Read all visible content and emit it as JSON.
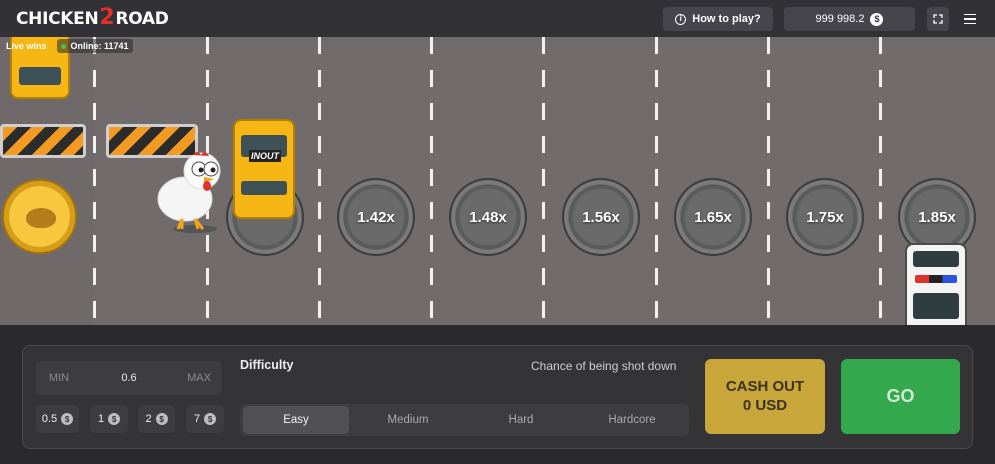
{
  "header": {
    "logo_left": "CHICKEN",
    "logo_num": "2",
    "logo_right": "ROAD",
    "how_to_play": "How to play?",
    "balance": "999 998.2",
    "currency_symbol": "$",
    "icons": [
      "info-icon",
      "coin-icon",
      "fullscreen-icon",
      "menu-icon"
    ]
  },
  "live": {
    "live_wins_label": "Live wins",
    "online_label": "Online: 11741",
    "online_dot_color": "#3ec35a"
  },
  "road": {
    "car_label": "INOUT",
    "multipliers": [
      "1.42x",
      "1.48x",
      "1.56x",
      "1.65x",
      "1.75x",
      "1.85x"
    ]
  },
  "controls": {
    "bet": {
      "min_label": "MIN",
      "value": "0.6",
      "max_label": "MAX"
    },
    "quick_bets": [
      "0.5",
      "1",
      "2",
      "7"
    ],
    "difficulty_title": "Difficulty",
    "chance_label": "Chance of being shot down",
    "difficulties": [
      "Easy",
      "Medium",
      "Hard",
      "Hardcore"
    ],
    "selected_difficulty": "Easy",
    "cashout_line1": "CASH OUT",
    "cashout_line2": "0 USD",
    "go_label": "GO"
  },
  "colors": {
    "road": "#716c6b",
    "cashout": "#c9a63a",
    "go": "#33a84d",
    "header": "#313136",
    "panel": "#343437"
  }
}
